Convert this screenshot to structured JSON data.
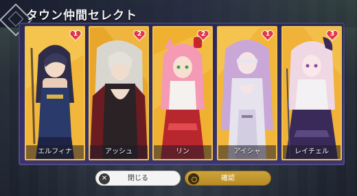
{
  "header": {
    "title": "タウン仲間セレクト"
  },
  "companions": [
    {
      "name": "エルフィナ",
      "affection": "1",
      "bg_color": "#f2b73a",
      "hair_color": "#3a3a5a",
      "outfit_color": "#2a3a6a"
    },
    {
      "name": "アッシュ",
      "affection": "2",
      "bg_color": "#e8a62a",
      "hair_color": "#d9d6cf",
      "outfit_color": "#2a2224"
    },
    {
      "name": "リン",
      "affection": "2",
      "bg_color": "#f0b030",
      "hair_color": "#f49ab4",
      "outfit_color": "#b8262e"
    },
    {
      "name": "アイシャ",
      "affection": "1",
      "bg_color": "#f2b73a",
      "hair_color": "#c9a8d8",
      "outfit_color": "#e6e3ee"
    },
    {
      "name": "レイチェル",
      "affection": "3",
      "bg_color": "#f0b238",
      "hair_color": "#efd8e4",
      "outfit_color": "#3a2a5a"
    }
  ],
  "footer": {
    "close_label": "閉じる",
    "confirm_label": "確認",
    "close_icon": "close-icon",
    "confirm_icon": "circle-icon"
  },
  "colors": {
    "panel": "#2b2858",
    "card_border": "#f1c34a",
    "heart": "#e0384a",
    "confirm_button": "#cfa33a"
  }
}
